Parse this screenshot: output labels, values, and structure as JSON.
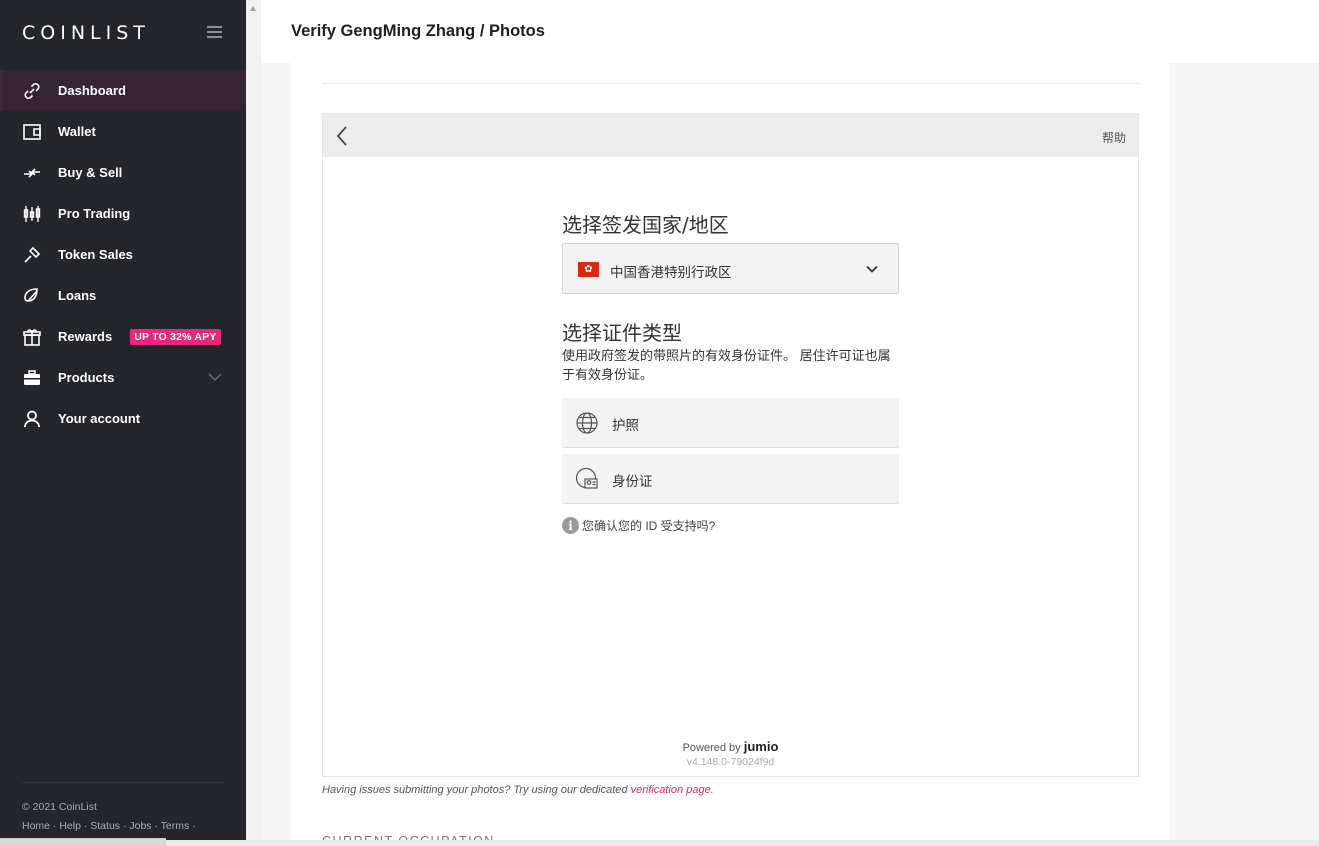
{
  "brand": {
    "logo": "COINLIST"
  },
  "sidebar": {
    "items": [
      {
        "label": "Dashboard",
        "icon": "link-icon",
        "active": true
      },
      {
        "label": "Wallet",
        "icon": "wallet-icon"
      },
      {
        "label": "Buy & Sell",
        "icon": "arrows-exchange-icon"
      },
      {
        "label": "Pro Trading",
        "icon": "candlestick-icon"
      },
      {
        "label": "Token Sales",
        "icon": "tag-icon"
      },
      {
        "label": "Loans",
        "icon": "loan-icon"
      },
      {
        "label": "Rewards",
        "icon": "gift-icon",
        "badge": "UP TO 32% APY"
      },
      {
        "label": "Products",
        "icon": "briefcase-icon"
      },
      {
        "label": "Your account",
        "icon": "user-icon"
      }
    ],
    "footer": {
      "copyright": "© 2021 CoinList",
      "links": "Home · Help · Status · Jobs · Terms ·"
    }
  },
  "header": {
    "title": "Verify GengMing Zhang / Photos"
  },
  "jumio": {
    "help": "帮助",
    "country_title": "选择签发国家/地区",
    "country_value": "中国香港特别行政区",
    "doc_title": "选择证件类型",
    "doc_desc": "使用政府签发的带照片的有效身份证件。 居住许可证也属于有效身份证。",
    "options": [
      "护照",
      "身份证"
    ],
    "info_text": "您确认您的 ID 受支持吗?",
    "powered_prefix": "Powered by",
    "powered_brand": "jumio",
    "version": "v4.148.0-79024f9d"
  },
  "issue": {
    "text": "Having issues submitting your photos? Try using our dedicated",
    "link": "verification page."
  },
  "next_section": "CURRENT OCCUPATION",
  "colors": {
    "sidebar": "#24262c",
    "accent": "#e6287c",
    "link": "#d6286f"
  }
}
